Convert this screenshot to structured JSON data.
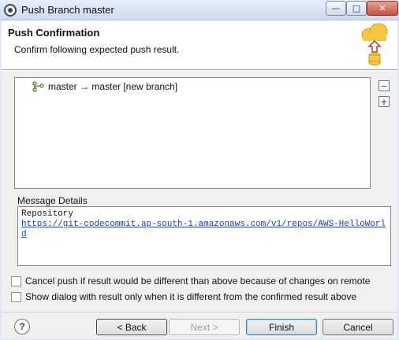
{
  "window": {
    "title": "Push Branch master"
  },
  "header": {
    "title": "Push Confirmation",
    "subtitle": "Confirm following expected push result."
  },
  "tree": {
    "items": [
      {
        "label": "master → master [new branch]"
      }
    ]
  },
  "message_details": {
    "label": "Message Details",
    "line1": "Repository",
    "url": "https://git-codecommit.ap-south-1.amazonaws.com/v1/repos/AWS-HelloWorld"
  },
  "options": [
    {
      "label": "Cancel push if result would be different than above because of changes on remote",
      "checked": false
    },
    {
      "label": "Show dialog with result only when it is different from the confirmed result above",
      "checked": false
    }
  ],
  "buttons": {
    "back": "< Back",
    "next": "Next >",
    "finish": "Finish",
    "cancel": "Cancel",
    "help": "?"
  },
  "colors": {
    "accent": "#3c7fb1",
    "link": "#0b44c9"
  }
}
